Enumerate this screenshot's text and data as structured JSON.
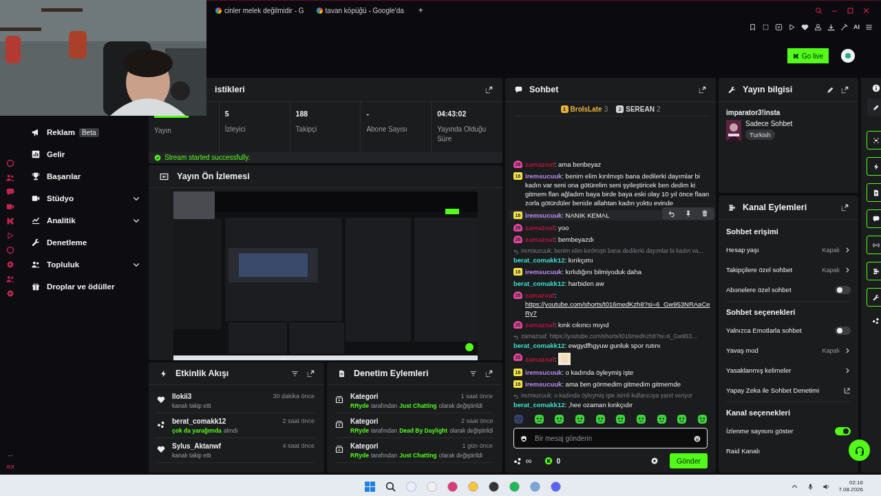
{
  "browser": {
    "tabs": [
      {
        "title": "cinler melek değilmidir - G",
        "selected": false
      },
      {
        "title": "tavan köpüğü - Google'da",
        "selected": false
      }
    ],
    "new_tab": "+",
    "ai_label": "AI"
  },
  "header": {
    "go_live": "Go live"
  },
  "browser_sidebar": {
    "brand": "GX",
    "more": "..."
  },
  "nav": {
    "items": [
      {
        "label": "Reklam",
        "badge": "Beta",
        "has_submenu": false
      },
      {
        "label": "Gelir",
        "has_submenu": false
      },
      {
        "label": "Başarılar",
        "has_submenu": false
      },
      {
        "label": "Stüdyo",
        "has_submenu": true
      },
      {
        "label": "Analitik",
        "has_submenu": true
      },
      {
        "label": "Denetleme",
        "has_submenu": false
      },
      {
        "label": "Topluluk",
        "has_submenu": true
      },
      {
        "label": "Droplar ve ödüller",
        "has_submenu": false
      }
    ]
  },
  "stats": {
    "title": "istikleri",
    "first_label": "Yayın",
    "items": [
      {
        "value": "5",
        "label": "İzleyici"
      },
      {
        "value": "188",
        "label": "Takipçi"
      },
      {
        "value": "-",
        "label": "Abone Sayısı"
      },
      {
        "value": "04:43:02",
        "label": "Yayında Olduğu Süre"
      }
    ],
    "notice": "Stream started successfully."
  },
  "preview": {
    "title": "Yayın Ön İzlemesi",
    "kind": "picture"
  },
  "activity": {
    "title": "Etkinlik Akışı",
    "events": [
      {
        "kind": "follow",
        "user": "llokii3",
        "time": "30 dakika önce",
        "parts": [
          {
            "text": "kanalı takip etti",
            "highlight": false
          }
        ]
      },
      {
        "kind": "reward",
        "user": "berat_comakk12",
        "time": "2 saat önce",
        "parts": [
          {
            "text": "çok da yarağımda",
            "highlight": true
          },
          {
            "text": "alındı",
            "highlight": false
          }
        ]
      },
      {
        "kind": "follow",
        "user": "Sylus_Aktanwf",
        "time": "4 saat önce",
        "parts": [
          {
            "text": "kanalı takip etti",
            "highlight": false
          }
        ]
      }
    ]
  },
  "moderation": {
    "title": "Denetim Eylemleri",
    "actions": [
      {
        "title": "Kategori",
        "time": "1 saat önce",
        "parts": [
          {
            "text": "RRyde",
            "highlight": true
          },
          {
            "text": "tarafından",
            "highlight": false
          },
          {
            "text": "Just Chatting",
            "highlight": true
          },
          {
            "text": "olarak değiştirildi",
            "highlight": false
          }
        ]
      },
      {
        "title": "Kategori",
        "time": "2 saat önce",
        "parts": [
          {
            "text": "RRyde",
            "highlight": true
          },
          {
            "text": "tarafından",
            "highlight": false
          },
          {
            "text": "Dead By Daylight",
            "highlight": true
          },
          {
            "text": "olarak değiştirildi",
            "highlight": false
          }
        ]
      },
      {
        "title": "Kategori",
        "time": "1 gün önce",
        "parts": [
          {
            "text": "RRyde",
            "highlight": true
          },
          {
            "text": "tarafından",
            "highlight": false
          },
          {
            "text": "Just Chatting",
            "highlight": true
          },
          {
            "text": "olarak değiştirildi",
            "highlight": false
          }
        ]
      }
    ]
  },
  "chat": {
    "title": "Sohbet",
    "leaders": [
      {
        "rank": "1",
        "name": "BroIsLate",
        "count": "3",
        "color": "#e8b23a"
      },
      {
        "rank": "2",
        "name": "SEREAN",
        "count": "2",
        "color": "#d4d7da"
      }
    ],
    "messages": [
      {
        "user": "zamazoaf",
        "color": "#b3133f",
        "badge": {
          "kind": "gift",
          "text": "26",
          "color": "#e5479e"
        },
        "text": ": ama benbeyaz"
      },
      {
        "user": "iremsucuuk",
        "color": "#b98af0",
        "badge": {
          "kind": "sub",
          "text": "16",
          "color": "#f3e24a"
        },
        "text": ": benim elim kırılmıştı bana dedilerki dayımlar bi kadın var seni ona götürelim seni şyileştiricek ben dedim ki gitmem flan ağladım baya birde baya eski olay 10 yıl önce flaan zorla götürdüler benide allahtan kadın yoktu evinde"
      },
      {
        "user": "iremsucuuk",
        "color": "#b98af0",
        "badge": {
          "kind": "sub",
          "text": "16",
          "color": "#f3e24a"
        },
        "text": ": NANIK KEMAL",
        "hovered": true
      },
      {
        "user": "zamazoaf",
        "color": "#b3133f",
        "badge": {
          "kind": "gift",
          "text": "26",
          "color": "#e5479e"
        },
        "text": ": yoo"
      },
      {
        "user": "zamazoaf",
        "color": "#b3133f",
        "badge": {
          "kind": "gift",
          "text": "26",
          "color": "#e5479e"
        },
        "text": ": bembeyazdı"
      },
      {
        "reply_to": "iremsucuuk: benim elim kırılmıştı bana dedilerki dayımlar bi kadın va...",
        "user": "berat_comakk12",
        "color": "#3fe0d0",
        "text": ": kırıkçımı"
      },
      {
        "user": "iremsucuuk",
        "color": "#b98af0",
        "badge": {
          "kind": "sub",
          "text": "16",
          "color": "#f3e24a"
        },
        "text": ": kırlıdığını bilmiyoduk daha"
      },
      {
        "user": "berat_comakk12",
        "color": "#3fe0d0",
        "text": ": harbiden aw"
      },
      {
        "user": "zamazoaf",
        "color": "#b3133f",
        "badge": {
          "kind": "gift",
          "text": "26",
          "color": "#e5479e"
        },
        "text": ":",
        "link": "https://youtube.com/shorts/t016medKzh8?si=6_Gw953NRAaCeRy7"
      },
      {
        "user": "zamazoaf",
        "color": "#b3133f",
        "badge": {
          "kind": "gift",
          "text": "26",
          "color": "#e5479e"
        },
        "text": ": kınk cıkıncı mıyıd"
      },
      {
        "reply_to": "zamazoaf: https://youtube.com/shorts/t016medKzh8?si=6_Gw953...",
        "user": "berat_comakk12",
        "color": "#3fe0d0",
        "text": ": ewgydfhgyuw gunluk spor rutını"
      },
      {
        "user": "zamazoaf",
        "color": "#b3133f",
        "badge": {
          "kind": "gift",
          "text": "26",
          "color": "#e5479e"
        },
        "text": ":",
        "emote": true
      },
      {
        "user": "iremsucuuk",
        "color": "#b98af0",
        "badge": {
          "kind": "sub",
          "text": "16",
          "color": "#f3e24a"
        },
        "text": ": o kadında öyleymiş işte"
      },
      {
        "user": "iremsucuuk",
        "color": "#b98af0",
        "badge": {
          "kind": "sub",
          "text": "16",
          "color": "#f3e24a"
        },
        "text": ": ama ben görmedim gitmedim gitmemde"
      },
      {
        "reply_to": "iremsucuuk: o kadında öyleymiş işte isimli kullanıcıya yanıt veriyor",
        "user": "berat_comakk12",
        "color": "#3fe0d0",
        "text": ": ,hee ozaman kınkçıdır"
      }
    ],
    "input": {
      "placeholder": "Bir mesaj gönderin"
    },
    "points": "∞",
    "coins": "0",
    "send": "Gönder"
  },
  "stream_info": {
    "title": "Yayın bilgisi",
    "stream_title": "imparator3!insta",
    "category": "Sadece Sohbet",
    "tag": "Turkish"
  },
  "channel_actions": {
    "title": "Kanal Eylemleri",
    "sections": [
      {
        "title": "Sohbet erişimi",
        "rows": [
          {
            "kind": "value",
            "label": "Hesap yaşı",
            "value": "Kapalı"
          },
          {
            "kind": "value",
            "label": "Takipçilere özel sohbet",
            "value": "Kapalı"
          },
          {
            "kind": "toggle",
            "label": "Abonelere özel sohbet",
            "on": false
          }
        ]
      },
      {
        "title": "Sohbet seçenekleri",
        "rows": [
          {
            "kind": "toggle",
            "label": "Yalnızca Emotlarla sohbet",
            "on": false
          },
          {
            "kind": "value",
            "label": "Yavaş mod",
            "value": "Kapalı"
          },
          {
            "kind": "link",
            "label": "Yasaklanmış kelimeler"
          },
          {
            "kind": "external",
            "label": "Yapay Zeka ile Sohbet Denetimi"
          }
        ]
      },
      {
        "title": "Kanal seçenekleri",
        "rows": [
          {
            "kind": "toggle",
            "label": "İzlenme sayısını göster",
            "on": true
          },
          {
            "kind": "plain",
            "label": "Raid Kanalı"
          }
        ]
      }
    ]
  },
  "taskbar": {
    "time": "02:16",
    "date": "7.08.2026"
  }
}
